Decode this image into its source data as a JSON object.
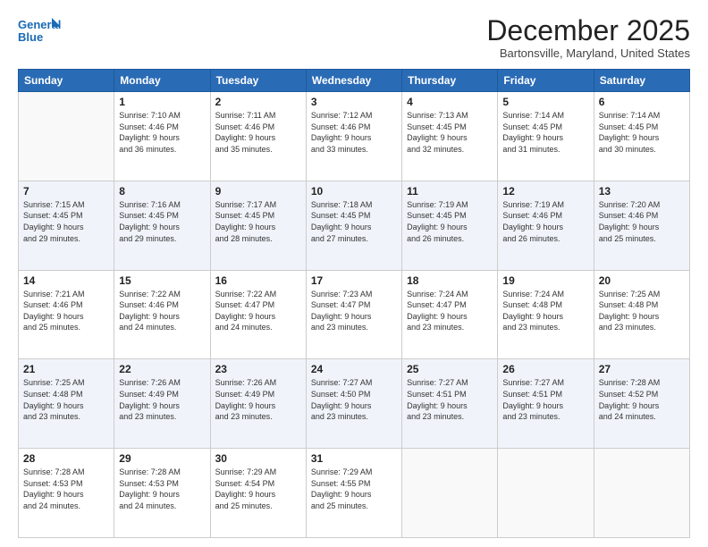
{
  "header": {
    "logo_line1": "General",
    "logo_line2": "Blue",
    "month_title": "December 2025",
    "location": "Bartonsville, Maryland, United States"
  },
  "days_header": [
    "Sunday",
    "Monday",
    "Tuesday",
    "Wednesday",
    "Thursday",
    "Friday",
    "Saturday"
  ],
  "weeks": [
    [
      {
        "day": "",
        "info": ""
      },
      {
        "day": "1",
        "info": "Sunrise: 7:10 AM\nSunset: 4:46 PM\nDaylight: 9 hours\nand 36 minutes."
      },
      {
        "day": "2",
        "info": "Sunrise: 7:11 AM\nSunset: 4:46 PM\nDaylight: 9 hours\nand 35 minutes."
      },
      {
        "day": "3",
        "info": "Sunrise: 7:12 AM\nSunset: 4:46 PM\nDaylight: 9 hours\nand 33 minutes."
      },
      {
        "day": "4",
        "info": "Sunrise: 7:13 AM\nSunset: 4:45 PM\nDaylight: 9 hours\nand 32 minutes."
      },
      {
        "day": "5",
        "info": "Sunrise: 7:14 AM\nSunset: 4:45 PM\nDaylight: 9 hours\nand 31 minutes."
      },
      {
        "day": "6",
        "info": "Sunrise: 7:14 AM\nSunset: 4:45 PM\nDaylight: 9 hours\nand 30 minutes."
      }
    ],
    [
      {
        "day": "7",
        "info": "Sunrise: 7:15 AM\nSunset: 4:45 PM\nDaylight: 9 hours\nand 29 minutes."
      },
      {
        "day": "8",
        "info": "Sunrise: 7:16 AM\nSunset: 4:45 PM\nDaylight: 9 hours\nand 29 minutes."
      },
      {
        "day": "9",
        "info": "Sunrise: 7:17 AM\nSunset: 4:45 PM\nDaylight: 9 hours\nand 28 minutes."
      },
      {
        "day": "10",
        "info": "Sunrise: 7:18 AM\nSunset: 4:45 PM\nDaylight: 9 hours\nand 27 minutes."
      },
      {
        "day": "11",
        "info": "Sunrise: 7:19 AM\nSunset: 4:45 PM\nDaylight: 9 hours\nand 26 minutes."
      },
      {
        "day": "12",
        "info": "Sunrise: 7:19 AM\nSunset: 4:46 PM\nDaylight: 9 hours\nand 26 minutes."
      },
      {
        "day": "13",
        "info": "Sunrise: 7:20 AM\nSunset: 4:46 PM\nDaylight: 9 hours\nand 25 minutes."
      }
    ],
    [
      {
        "day": "14",
        "info": "Sunrise: 7:21 AM\nSunset: 4:46 PM\nDaylight: 9 hours\nand 25 minutes."
      },
      {
        "day": "15",
        "info": "Sunrise: 7:22 AM\nSunset: 4:46 PM\nDaylight: 9 hours\nand 24 minutes."
      },
      {
        "day": "16",
        "info": "Sunrise: 7:22 AM\nSunset: 4:47 PM\nDaylight: 9 hours\nand 24 minutes."
      },
      {
        "day": "17",
        "info": "Sunrise: 7:23 AM\nSunset: 4:47 PM\nDaylight: 9 hours\nand 23 minutes."
      },
      {
        "day": "18",
        "info": "Sunrise: 7:24 AM\nSunset: 4:47 PM\nDaylight: 9 hours\nand 23 minutes."
      },
      {
        "day": "19",
        "info": "Sunrise: 7:24 AM\nSunset: 4:48 PM\nDaylight: 9 hours\nand 23 minutes."
      },
      {
        "day": "20",
        "info": "Sunrise: 7:25 AM\nSunset: 4:48 PM\nDaylight: 9 hours\nand 23 minutes."
      }
    ],
    [
      {
        "day": "21",
        "info": "Sunrise: 7:25 AM\nSunset: 4:48 PM\nDaylight: 9 hours\nand 23 minutes."
      },
      {
        "day": "22",
        "info": "Sunrise: 7:26 AM\nSunset: 4:49 PM\nDaylight: 9 hours\nand 23 minutes."
      },
      {
        "day": "23",
        "info": "Sunrise: 7:26 AM\nSunset: 4:49 PM\nDaylight: 9 hours\nand 23 minutes."
      },
      {
        "day": "24",
        "info": "Sunrise: 7:27 AM\nSunset: 4:50 PM\nDaylight: 9 hours\nand 23 minutes."
      },
      {
        "day": "25",
        "info": "Sunrise: 7:27 AM\nSunset: 4:51 PM\nDaylight: 9 hours\nand 23 minutes."
      },
      {
        "day": "26",
        "info": "Sunrise: 7:27 AM\nSunset: 4:51 PM\nDaylight: 9 hours\nand 23 minutes."
      },
      {
        "day": "27",
        "info": "Sunrise: 7:28 AM\nSunset: 4:52 PM\nDaylight: 9 hours\nand 24 minutes."
      }
    ],
    [
      {
        "day": "28",
        "info": "Sunrise: 7:28 AM\nSunset: 4:53 PM\nDaylight: 9 hours\nand 24 minutes."
      },
      {
        "day": "29",
        "info": "Sunrise: 7:28 AM\nSunset: 4:53 PM\nDaylight: 9 hours\nand 24 minutes."
      },
      {
        "day": "30",
        "info": "Sunrise: 7:29 AM\nSunset: 4:54 PM\nDaylight: 9 hours\nand 25 minutes."
      },
      {
        "day": "31",
        "info": "Sunrise: 7:29 AM\nSunset: 4:55 PM\nDaylight: 9 hours\nand 25 minutes."
      },
      {
        "day": "",
        "info": ""
      },
      {
        "day": "",
        "info": ""
      },
      {
        "day": "",
        "info": ""
      }
    ]
  ]
}
